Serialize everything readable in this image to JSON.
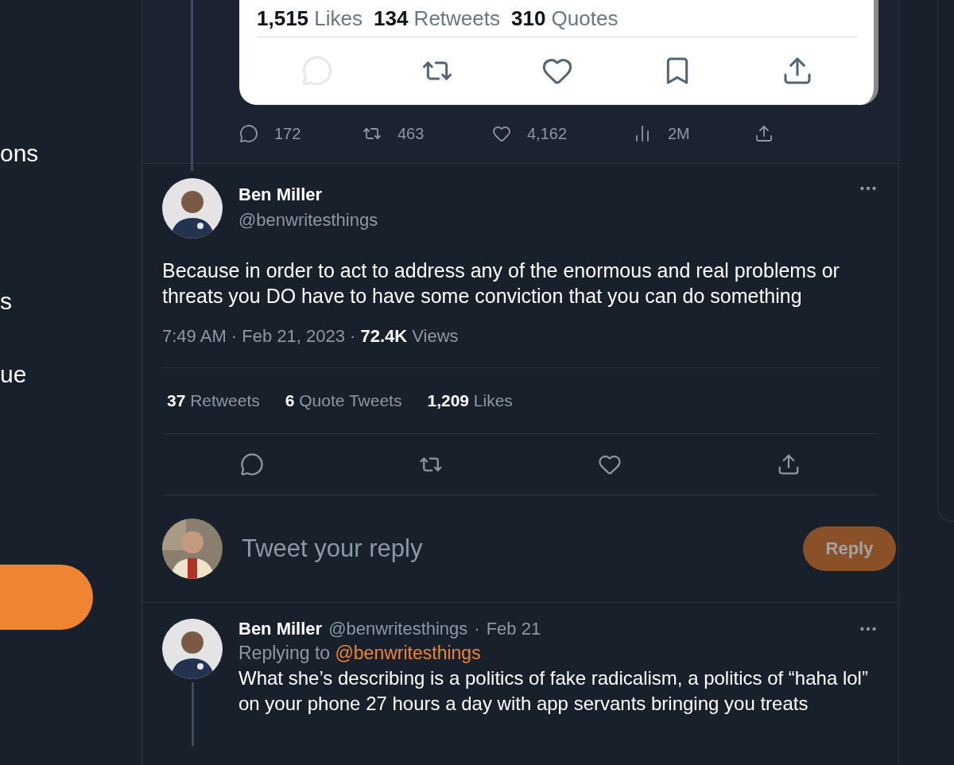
{
  "sidebar": {
    "items": [
      {
        "label": "ons"
      },
      {
        "label": "s"
      },
      {
        "label": "ue"
      }
    ]
  },
  "quoted_card": {
    "stats": [
      "**1,515** Likes",
      "**134** Retweets",
      "**310** Quotes"
    ],
    "actions": [
      {
        "kind": "reply",
        "disabled": true
      },
      {
        "kind": "retweet",
        "disabled": false
      },
      {
        "kind": "like",
        "disabled": false
      },
      {
        "kind": "bookmark",
        "disabled": false
      },
      {
        "kind": "share",
        "disabled": false
      }
    ]
  },
  "previous_tweet": {
    "actions": [
      {
        "kind": "reply",
        "count": "172"
      },
      {
        "kind": "retweet",
        "count": "463"
      },
      {
        "kind": "like",
        "count": "4,162"
      },
      {
        "kind": "views",
        "count": "2M"
      },
      {
        "kind": "share"
      }
    ]
  },
  "main_tweet": {
    "name": "Ben Miller",
    "handle": "@benwritesthings",
    "text": "Because in order to act to address any of the enormous and real problems or threats you DO have to have some conviction that you can do something",
    "meta": "7:49 AM · Feb 21, 2023 · **72.4K** Views",
    "stats": [
      "**37** Retweets",
      "**6** Quote Tweets",
      "**1,209** Likes"
    ],
    "actions": [
      {
        "kind": "reply"
      },
      {
        "kind": "retweet"
      },
      {
        "kind": "like"
      },
      {
        "kind": "share"
      }
    ]
  },
  "reply_box": {
    "placeholder": "Tweet your reply",
    "button": "Reply",
    "disabled": true
  },
  "reply_tweet": {
    "name": "Ben Miller",
    "handle": "@benwritesthings",
    "separator": "·",
    "date": "Feb 21",
    "replying_label": "Replying to",
    "replying_handle": "@benwritesthings",
    "text": "What she’s describing is a politics of fake radicalism, a politics of “haha lol” on your phone 27 hours a day with app servants bringing you treats"
  }
}
